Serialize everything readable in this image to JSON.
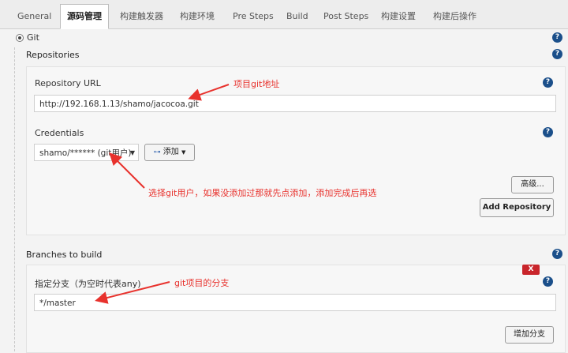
{
  "tabs": [
    "General",
    "源码管理",
    "构建触发器",
    "构建环境",
    "Pre Steps",
    "Build",
    "Post Steps",
    "构建设置",
    "构建后操作"
  ],
  "scm": {
    "git_label": "Git"
  },
  "repositories": {
    "section_title": "Repositories",
    "url_label": "Repository URL",
    "url_value": "http://192.168.1.13/shamo/jacocoa.git",
    "credentials_label": "Credentials",
    "credentials_value": "shamo/****** (git用户)",
    "add_button": "添加",
    "advanced_button": "高级...",
    "add_repository_button": "Add Repository"
  },
  "branches": {
    "section_title": "Branches to build",
    "branch_label": "指定分支（为空时代表any)",
    "branch_value": "*/master",
    "delete_label": "X",
    "add_branch_button": "增加分支"
  },
  "annotations": {
    "repo_url_note": "项目git地址",
    "credentials_note": "选择git用户，如果没添加过那就先点添加，添加完成后再选",
    "branch_note": "git项目的分支"
  },
  "help_glyph": "?",
  "colors": {
    "annotation": "#e8322d",
    "help_icon": "#1b4f8a",
    "delete_button": "#c9252b"
  }
}
